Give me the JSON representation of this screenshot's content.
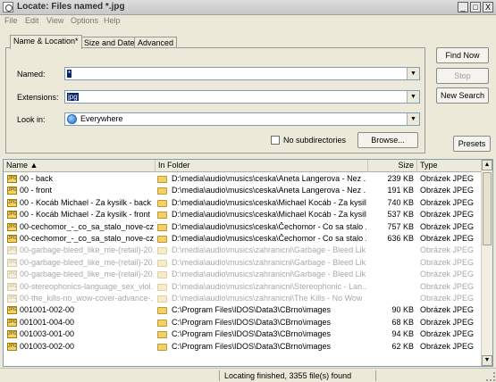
{
  "window": {
    "title": "Locate: Files named *.jpg",
    "buttons": {
      "minimize": "_",
      "maximize": "□",
      "close": "X"
    }
  },
  "menu": [
    "File",
    "Edit",
    "View",
    "Options",
    "Help"
  ],
  "tabs": [
    "Name & Location*",
    "Size and Date",
    "Advanced"
  ],
  "form": {
    "named_label": "Named:",
    "named_value": "*",
    "extensions_label": "Extensions:",
    "extensions_value": "jpg",
    "lookin_label": "Look in:",
    "lookin_value": "Everywhere",
    "lookin_icon": "globe-icon",
    "no_subdirectories_label": "No subdirectories",
    "no_subdirectories_checked": false,
    "browse_label": "Browse..."
  },
  "side_buttons": {
    "find_now": "Find Now",
    "stop": "Stop",
    "new_search": "New Search",
    "presets": "Presets"
  },
  "columns": [
    "Name",
    "In Folder",
    "Size",
    "Type"
  ],
  "rows": [
    {
      "name": "00 - back",
      "folder": "D:\\media\\audio\\musics\\ceska\\Aneta Langerova - Nez ...",
      "size": "239 KB",
      "type": "Obrázek JPEG",
      "dim": false
    },
    {
      "name": "00 - front",
      "folder": "D:\\media\\audio\\musics\\ceska\\Aneta Langerova - Nez ...",
      "size": "191 KB",
      "type": "Obrázek JPEG",
      "dim": false
    },
    {
      "name": "00 - Kocáb Michael - Za kysilk - back",
      "folder": "D:\\media\\audio\\musics\\ceska\\Michael Kocáb - Za kysilk",
      "size": "740 KB",
      "type": "Obrázek JPEG",
      "dim": false
    },
    {
      "name": "00 - Kocáb Michael - Za kysilk - front",
      "folder": "D:\\media\\audio\\musics\\ceska\\Michael Kocáb - Za kysilk",
      "size": "537 KB",
      "type": "Obrázek JPEG",
      "dim": false
    },
    {
      "name": "00-cechomor_-_co_sa_stalo_nove-cz...",
      "folder": "D:\\media\\audio\\musics\\ceska\\Čechomor - Co sa stalo ...",
      "size": "757 KB",
      "type": "Obrázek JPEG",
      "dim": false
    },
    {
      "name": "00-cechomor_-_co_sa_stalo_nove-cz...",
      "folder": "D:\\media\\audio\\musics\\ceska\\Čechomor - Co sa stalo ...",
      "size": "636 KB",
      "type": "Obrázek JPEG",
      "dim": false
    },
    {
      "name": "00-garbage-bleed_like_me-(retail)-20...",
      "folder": "D:\\media\\audio\\musics\\zahranicni\\Garbage - Bleed Lik...",
      "size": "",
      "type": "Obrázek JPEG",
      "dim": true
    },
    {
      "name": "00-garbage-bleed_like_me-(retail)-20...",
      "folder": "D:\\media\\audio\\musics\\zahranicni\\Garbage - Bleed Lik...",
      "size": "",
      "type": "Obrázek JPEG",
      "dim": true
    },
    {
      "name": "00-garbage-bleed_like_me-(retail)-20...",
      "folder": "D:\\media\\audio\\musics\\zahranicni\\Garbage - Bleed Lik...",
      "size": "",
      "type": "Obrázek JPEG",
      "dim": true
    },
    {
      "name": "00-stereophonics-language_sex_viol...",
      "folder": "D:\\media\\audio\\musics\\zahranicni\\Stereophonic - Lan...",
      "size": "",
      "type": "Obrázek JPEG",
      "dim": true
    },
    {
      "name": "00-the_kills-no_wow-cover-advance-...",
      "folder": "D:\\media\\audio\\musics\\zahranicni\\The Kills - No Wow",
      "size": "",
      "type": "Obrázek JPEG",
      "dim": true
    },
    {
      "name": "001001-002-00",
      "folder": "C:\\Program Files\\IDOS\\Data3\\CBrno\\images",
      "size": "90 KB",
      "type": "Obrázek JPEG",
      "dim": false
    },
    {
      "name": "001001-004-00",
      "folder": "C:\\Program Files\\IDOS\\Data3\\CBrno\\images",
      "size": "68 KB",
      "type": "Obrázek JPEG",
      "dim": false
    },
    {
      "name": "001003-001-00",
      "folder": "C:\\Program Files\\IDOS\\Data3\\CBrno\\images",
      "size": "94 KB",
      "type": "Obrázek JPEG",
      "dim": false
    },
    {
      "name": "001003-002-00",
      "folder": "C:\\Program Files\\IDOS\\Data3\\CBrno\\images",
      "size": "62 KB",
      "type": "Obrázek JPEG",
      "dim": false
    }
  ],
  "status": "Locating finished, 3355 file(s) found"
}
